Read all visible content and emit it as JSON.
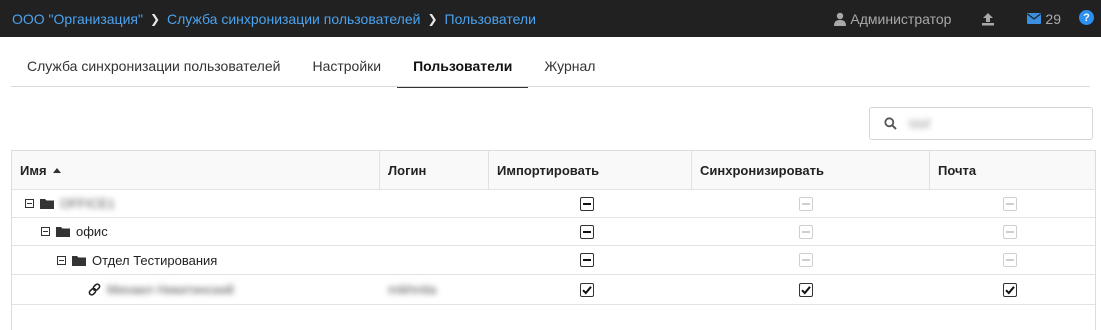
{
  "breadcrumbs": [
    {
      "label": "ООО \"Организация\""
    },
    {
      "label": "Служба синхронизации пользователей"
    },
    {
      "label": "Пользователи"
    }
  ],
  "header": {
    "user_name": "Администратор",
    "mail_count": "29",
    "help_label": "?",
    "accent_color": "#4aa3f0",
    "bar_color": "#212121"
  },
  "tabs": [
    {
      "label": "Служба синхронизации пользователей",
      "active": false
    },
    {
      "label": "Настройки",
      "active": false
    },
    {
      "label": "Пользователи",
      "active": true
    },
    {
      "label": "Журнал",
      "active": false
    }
  ],
  "search": {
    "value": "ldaf"
  },
  "table": {
    "columns": [
      "Имя",
      "Логин",
      "Импортировать",
      "Синхронизировать",
      "Почта"
    ],
    "sorted_column": "Имя",
    "rows": [
      {
        "name": "OFFICE1",
        "type": "folder",
        "login": "",
        "import": "indeterminate",
        "sync": "indeterminate-disabled",
        "mail": "indeterminate-disabled"
      },
      {
        "name": "офис",
        "type": "folder",
        "login": "",
        "import": "indeterminate",
        "sync": "indeterminate-disabled",
        "mail": "indeterminate-disabled"
      },
      {
        "name": "Отдел Тестирования",
        "type": "folder",
        "login": "",
        "import": "indeterminate",
        "sync": "indeterminate-disabled",
        "mail": "indeterminate-disabled"
      },
      {
        "name": "Михаил Никитинский",
        "type": "user-link",
        "login": "mikhnita",
        "import": "checked",
        "sync": "checked",
        "mail": "checked"
      }
    ]
  }
}
